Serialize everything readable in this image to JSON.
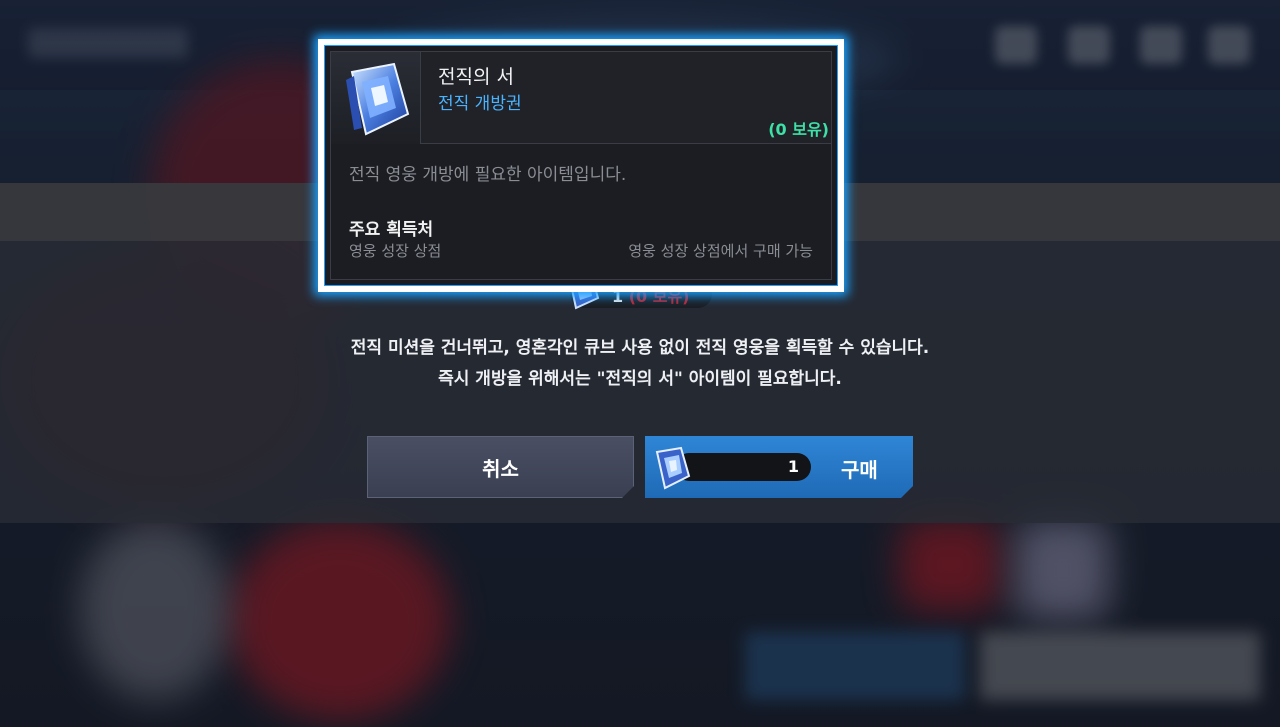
{
  "cost": {
    "quantity": "1",
    "owned": "(0 보유)"
  },
  "description": {
    "line1": "전직 미션을 건너뛰고, 영혼각인 큐브 사용 없이 전직 영웅을 획득할 수 있습니다.",
    "line2": "즉시 개방을 위해서는 \"전직의 서\" 아이템이 필요합니다."
  },
  "buttons": {
    "cancel_label": "취소",
    "buy_label": "구매",
    "buy_quantity": "1"
  },
  "tooltip": {
    "item_name": "전직의 서",
    "item_type": "전직 개방권",
    "owned": "(0 보유)",
    "description": "전직 영웅 개방에 필요한 아이템입니다.",
    "source_title": "주요 획득처",
    "source_name": "영웅 성장 상점",
    "source_detail": "영웅 성장 상점에서 구매 가능"
  },
  "colors": {
    "highlight": "#1aa2ff",
    "owned_zero": "#3ee0a6",
    "buy_button": "#2f86d6",
    "cancel_button": "#4a4f63",
    "item_type": "#4ab3ff"
  },
  "icons": {
    "item": "crystal-book-icon"
  }
}
